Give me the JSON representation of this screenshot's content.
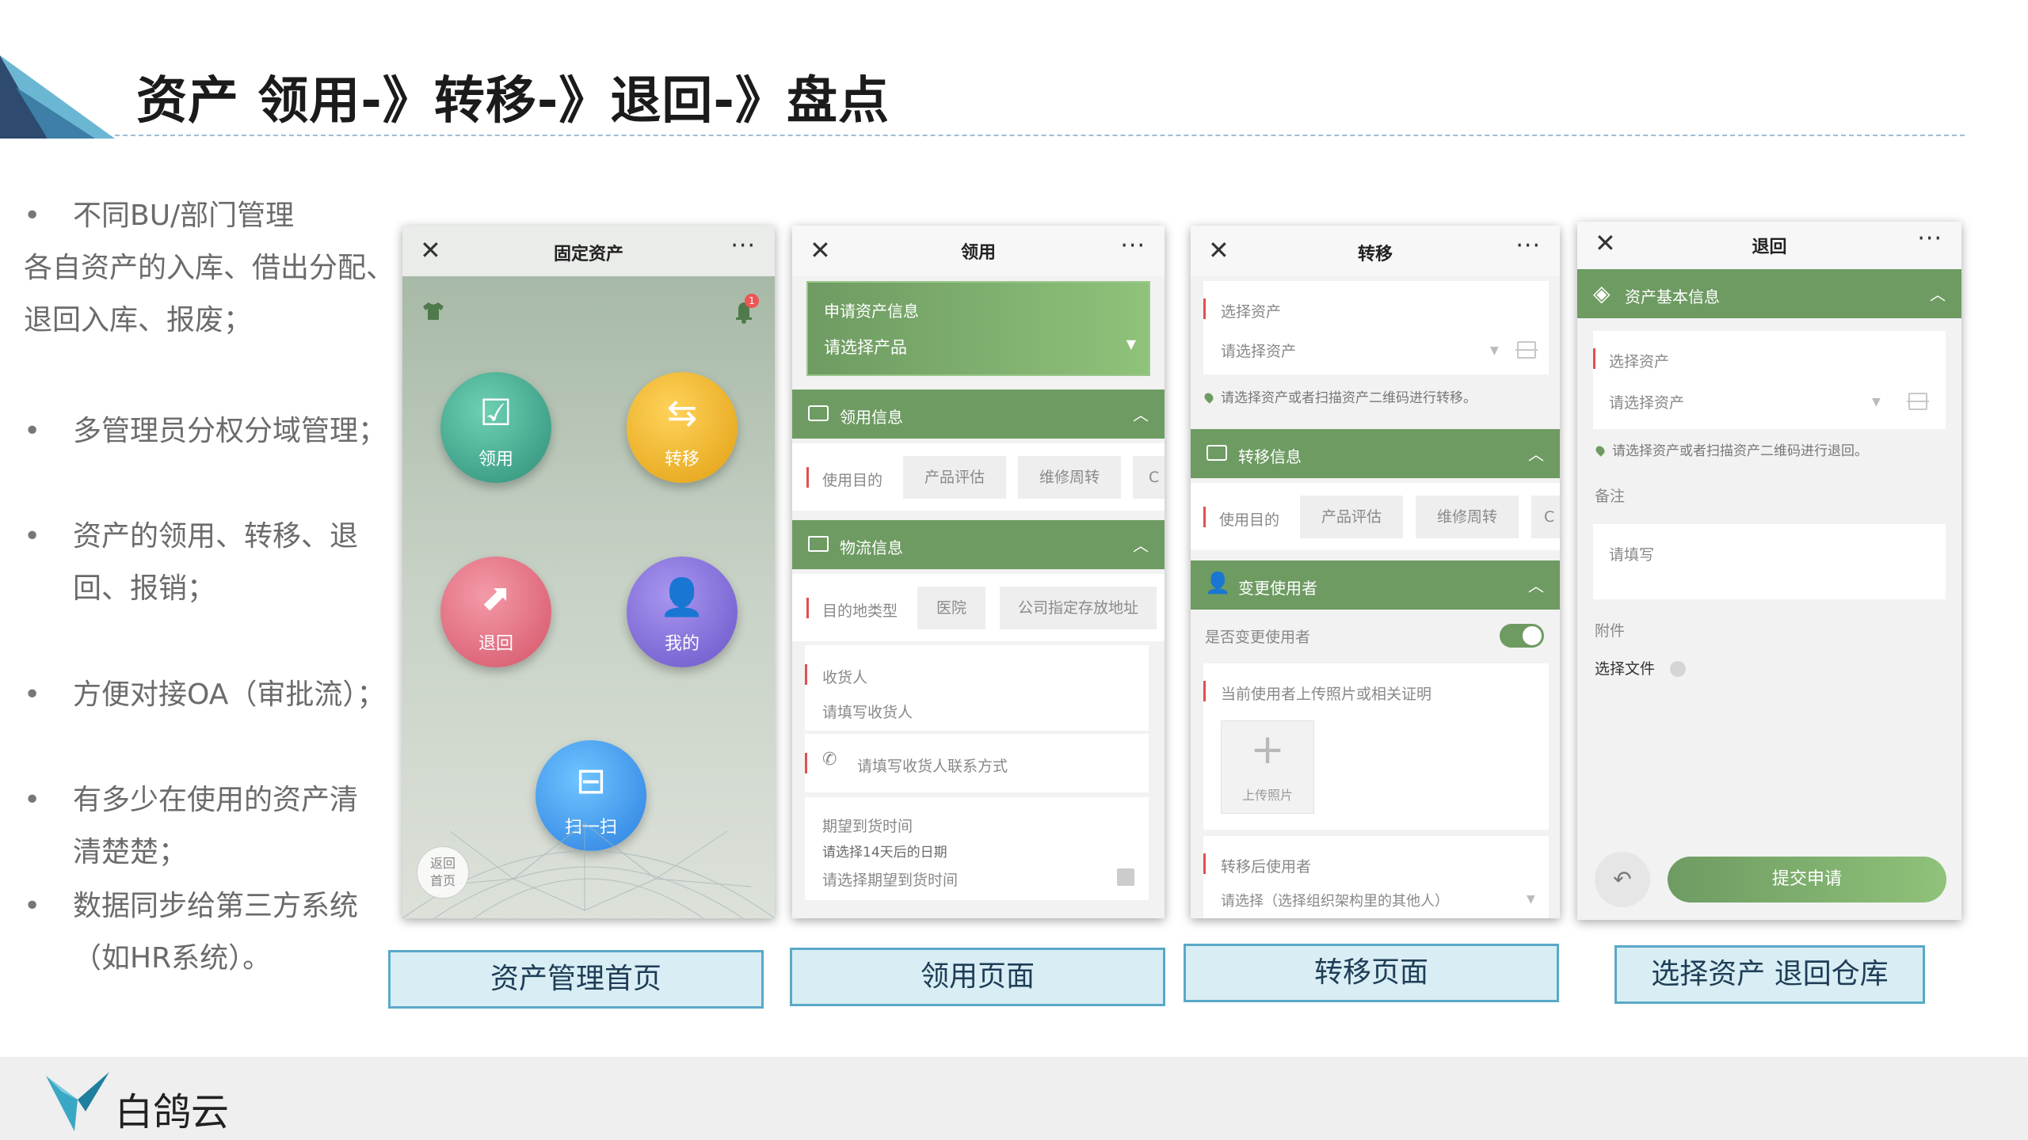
{
  "slide": {
    "title": "资产  领用-》转移-》退回-》盘点"
  },
  "bullets": [
    {
      "lines": [
        "不同BU/部门管理",
        "各自资产的入库、借出分配、",
        "退回入库、报废；"
      ]
    },
    {
      "lines": [
        "多管理员分权分域管理；"
      ]
    },
    {
      "lines": [
        "资产的领用、转移、退",
        "回、报销；"
      ]
    },
    {
      "lines": [
        "方便对接OA（审批流）；"
      ]
    },
    {
      "lines": [
        "有多少在使用的资产清",
        "清楚楚；"
      ]
    },
    {
      "lines": [
        "数据同步给第三方系统",
        "（如HR系统）。"
      ]
    }
  ],
  "phone1": {
    "title": "固定资产",
    "close": "✕",
    "more": "···",
    "badge": "1",
    "buttons": {
      "lingyong": "领用",
      "zhuanyi": "转移",
      "tuihui": "退回",
      "wode": "我的",
      "scan": "扫一扫"
    },
    "home": {
      "line1": "返回",
      "line2": "首页"
    }
  },
  "phone2": {
    "title": "领用",
    "close": "✕",
    "more": "···",
    "apply_label": "申请资产信息",
    "apply_select": "请选择产品",
    "section_lingyong": "领用信息",
    "purpose_label": "使用目的",
    "purpose_chip1": "产品评估",
    "purpose_chip2": "维修周转",
    "purpose_chip3": "C",
    "section_wuliu": "物流信息",
    "dest_label": "目的地类型",
    "dest_chip1": "医院",
    "dest_chip2": "公司指定存放地址",
    "receiver_label": "收货人",
    "receiver_placeholder": "请填写收货人",
    "phone_placeholder": "请填写收货人联系方式",
    "date_label": "期望到货时间",
    "date_hint": "请选择14天后的日期",
    "date_placeholder": "请选择期望到货时间"
  },
  "phone3": {
    "title": "转移",
    "close": "✕",
    "more": "···",
    "select_label": "选择资产",
    "select_placeholder": "请选择资产",
    "hint": "请选择资产或者扫描资产二维码进行转移。",
    "section_zhuanyi": "转移信息",
    "purpose_label": "使用目的",
    "purpose_chip1": "产品评估",
    "purpose_chip2": "维修周转",
    "purpose_chip3": "C",
    "section_user": "变更使用者",
    "change_user_label": "是否变更使用者",
    "upload_label": "当前使用者上传照片或相关证明",
    "upload_button": "上传照片",
    "new_user_label": "转移后使用者",
    "new_user_placeholder": "请选择（选择组织架构里的其他人）"
  },
  "phone4": {
    "title": "退回",
    "close": "✕",
    "more": "···",
    "section_basic": "资产基本信息",
    "select_label": "选择资产",
    "select_placeholder": "请选择资产",
    "hint": "请选择资产或者扫描资产二维码进行退回。",
    "remark_label": "备注",
    "remark_placeholder": "请填写",
    "attach_label": "附件",
    "file_label": "选择文件",
    "submit": "提交申请"
  },
  "captions": {
    "c1": "资产管理首页",
    "c2": "领用页面",
    "c3": "转移页面",
    "c4": "选择资产 退回仓库"
  },
  "footer": {
    "brand": "白鸽云"
  },
  "colors": {
    "accent_green": "#6e9b62",
    "caption_bg": "#d8eef4",
    "caption_border": "#5ba8c7",
    "title_rule": "#9fbfd8"
  }
}
